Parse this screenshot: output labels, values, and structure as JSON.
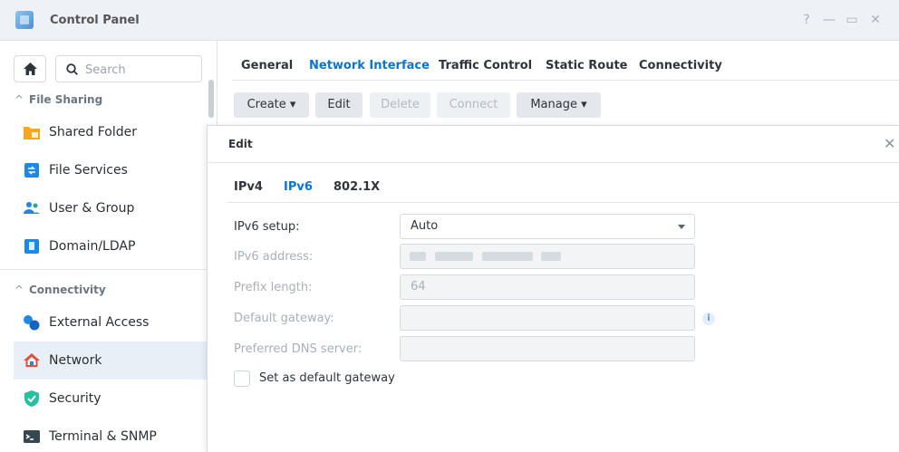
{
  "window": {
    "title": "Control Panel",
    "controls": [
      "?",
      "—",
      "▭",
      "✕"
    ]
  },
  "sidebar": {
    "search_placeholder": "Search",
    "sections": [
      {
        "label": "File Sharing",
        "items": [
          {
            "label": "Shared Folder",
            "icon": "shared-folder-icon"
          },
          {
            "label": "File Services",
            "icon": "file-services-icon"
          },
          {
            "label": "User & Group",
            "icon": "user-group-icon"
          },
          {
            "label": "Domain/LDAP",
            "icon": "domain-ldap-icon"
          }
        ]
      },
      {
        "label": "Connectivity",
        "items": [
          {
            "label": "External Access",
            "icon": "external-access-icon"
          },
          {
            "label": "Network",
            "icon": "network-icon",
            "active": true
          },
          {
            "label": "Security",
            "icon": "security-icon"
          },
          {
            "label": "Terminal & SNMP",
            "icon": "terminal-icon"
          }
        ]
      }
    ]
  },
  "main": {
    "tabs": [
      {
        "label": "General"
      },
      {
        "label": "Network Interface",
        "active": true
      },
      {
        "label": "Traffic Control"
      },
      {
        "label": "Static Route"
      },
      {
        "label": "Connectivity"
      }
    ],
    "toolbar": {
      "create": "Create ▾",
      "edit": "Edit",
      "delete": "Delete",
      "connect": "Connect",
      "manage": "Manage ▾"
    }
  },
  "dialog": {
    "title": "Edit",
    "tabs": [
      {
        "label": "IPv4"
      },
      {
        "label": "IPv6",
        "active": true
      },
      {
        "label": "802.1X"
      }
    ],
    "fields": {
      "ipv6_setup": {
        "label": "IPv6 setup:",
        "value": "Auto"
      },
      "ipv6_address": {
        "label": "IPv6 address:",
        "value": ""
      },
      "prefix_length": {
        "label": "Prefix length:",
        "value": "64"
      },
      "default_gateway": {
        "label": "Default gateway:",
        "value": ""
      },
      "preferred_dns": {
        "label": "Preferred DNS server:",
        "value": ""
      }
    },
    "set_default_gateway": {
      "label": "Set as default gateway",
      "checked": false
    }
  },
  "colors": {
    "accent": "#0b74d1",
    "active_nav_bg": "#e9eff7",
    "titlebar_bg": "#eef1f5"
  }
}
